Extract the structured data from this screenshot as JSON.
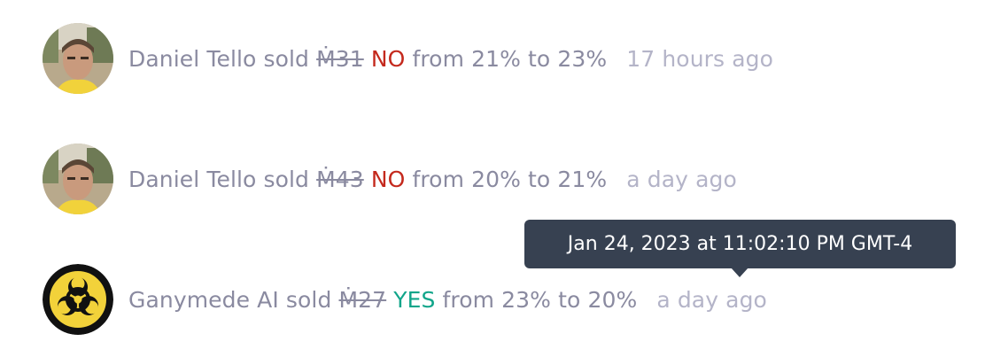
{
  "colors": {
    "text_muted": "#8a8aa0",
    "timestamp": "#b4b4c8",
    "no": "#c4291d",
    "yes": "#11a58a",
    "tooltip_bg": "#374151"
  },
  "trades": [
    {
      "avatar": "user-photo-avatar",
      "user": "Daniel Tello",
      "action": "sold",
      "amount": "Ṁ31",
      "outcome": "NO",
      "from_label": "from",
      "from": "21%",
      "to_label": "to",
      "to": "23%",
      "time": "17 hours ago"
    },
    {
      "avatar": "user-photo-avatar",
      "user": "Daniel Tello",
      "action": "sold",
      "amount": "Ṁ43",
      "outcome": "NO",
      "from_label": "from",
      "from": "20%",
      "to_label": "to",
      "to": "21%",
      "time": "a day ago"
    },
    {
      "avatar": "biohazard-avatar",
      "user": "Ganymede AI",
      "action": "sold",
      "amount": "Ṁ27",
      "outcome": "YES",
      "from_label": "from",
      "from": "23%",
      "to_label": "to",
      "to": "20%",
      "time": "a day ago"
    }
  ],
  "tooltip": {
    "text": "Jan 24, 2023 at 11:02:10 PM GMT-4"
  }
}
